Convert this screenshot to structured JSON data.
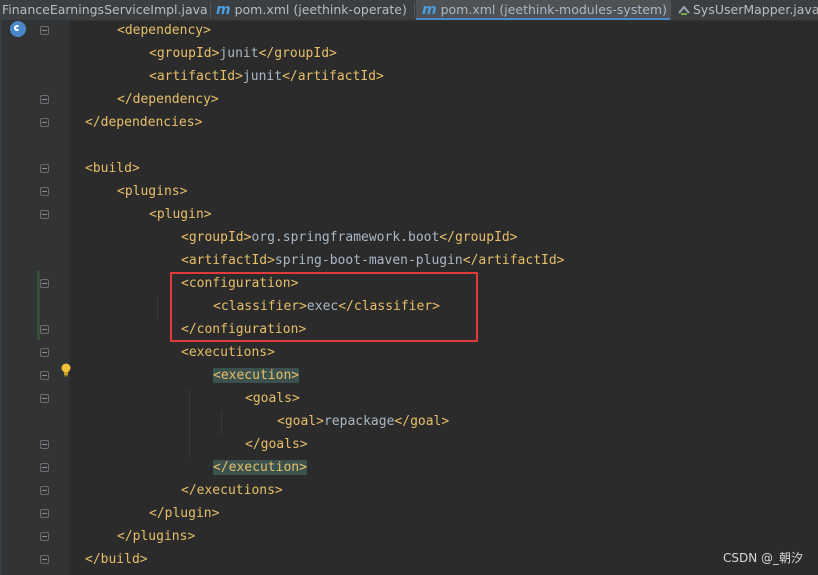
{
  "tabs": [
    {
      "label": "FinanceEarningsServiceImpl.java",
      "icon": "close-icon",
      "active": false
    },
    {
      "label": "pom.xml (jeethink-operate)",
      "icon": "maven-icon",
      "active": false
    },
    {
      "label": "pom.xml (jeethink-modules-system)",
      "icon": "maven-icon",
      "active": true
    },
    {
      "label": "SysUserMapper.java",
      "icon": "mapper-icon",
      "active": false
    }
  ],
  "tab_close_glyph": "×",
  "maven_glyph": "m",
  "code": {
    "lines": [
      {
        "indent": 1,
        "text": "<dependency>"
      },
      {
        "indent": 2,
        "text": "<groupId>junit</groupId>"
      },
      {
        "indent": 2,
        "text": "<artifactId>junit</artifactId>"
      },
      {
        "indent": 1,
        "text": "</dependency>"
      },
      {
        "indent": 0,
        "text": "</dependencies>"
      },
      {
        "indent": 0,
        "text": ""
      },
      {
        "indent": 0,
        "text": "<build>"
      },
      {
        "indent": 1,
        "text": "<plugins>"
      },
      {
        "indent": 2,
        "text": "<plugin>"
      },
      {
        "indent": 3,
        "text": "<groupId>org.springframework.boot</groupId>"
      },
      {
        "indent": 3,
        "text": "<artifactId>spring-boot-maven-plugin</artifactId>"
      },
      {
        "indent": 3,
        "text": "<configuration>"
      },
      {
        "indent": 4,
        "text": "<classifier>exec</classifier>"
      },
      {
        "indent": 3,
        "text": "</configuration>"
      },
      {
        "indent": 3,
        "text": "<executions>"
      },
      {
        "indent": 4,
        "text": "<execution>"
      },
      {
        "indent": 5,
        "text": "<goals>"
      },
      {
        "indent": 6,
        "text": "<goal>repackage</goal>"
      },
      {
        "indent": 5,
        "text": "</goals>"
      },
      {
        "indent": 4,
        "text": "</execution>"
      },
      {
        "indent": 3,
        "text": "</executions>"
      },
      {
        "indent": 2,
        "text": "</plugin>"
      },
      {
        "indent": 1,
        "text": "</plugins>"
      },
      {
        "indent": 0,
        "text": "</build>"
      }
    ]
  },
  "watermark": "CSDN @_朝汐",
  "colors": {
    "editor_bg": "#2b2b2b",
    "tag": "#e8bf6a",
    "text": "#a9b7c6",
    "highlight_box": "#e03b3b",
    "matched_tag_bg": "#3b514d"
  }
}
